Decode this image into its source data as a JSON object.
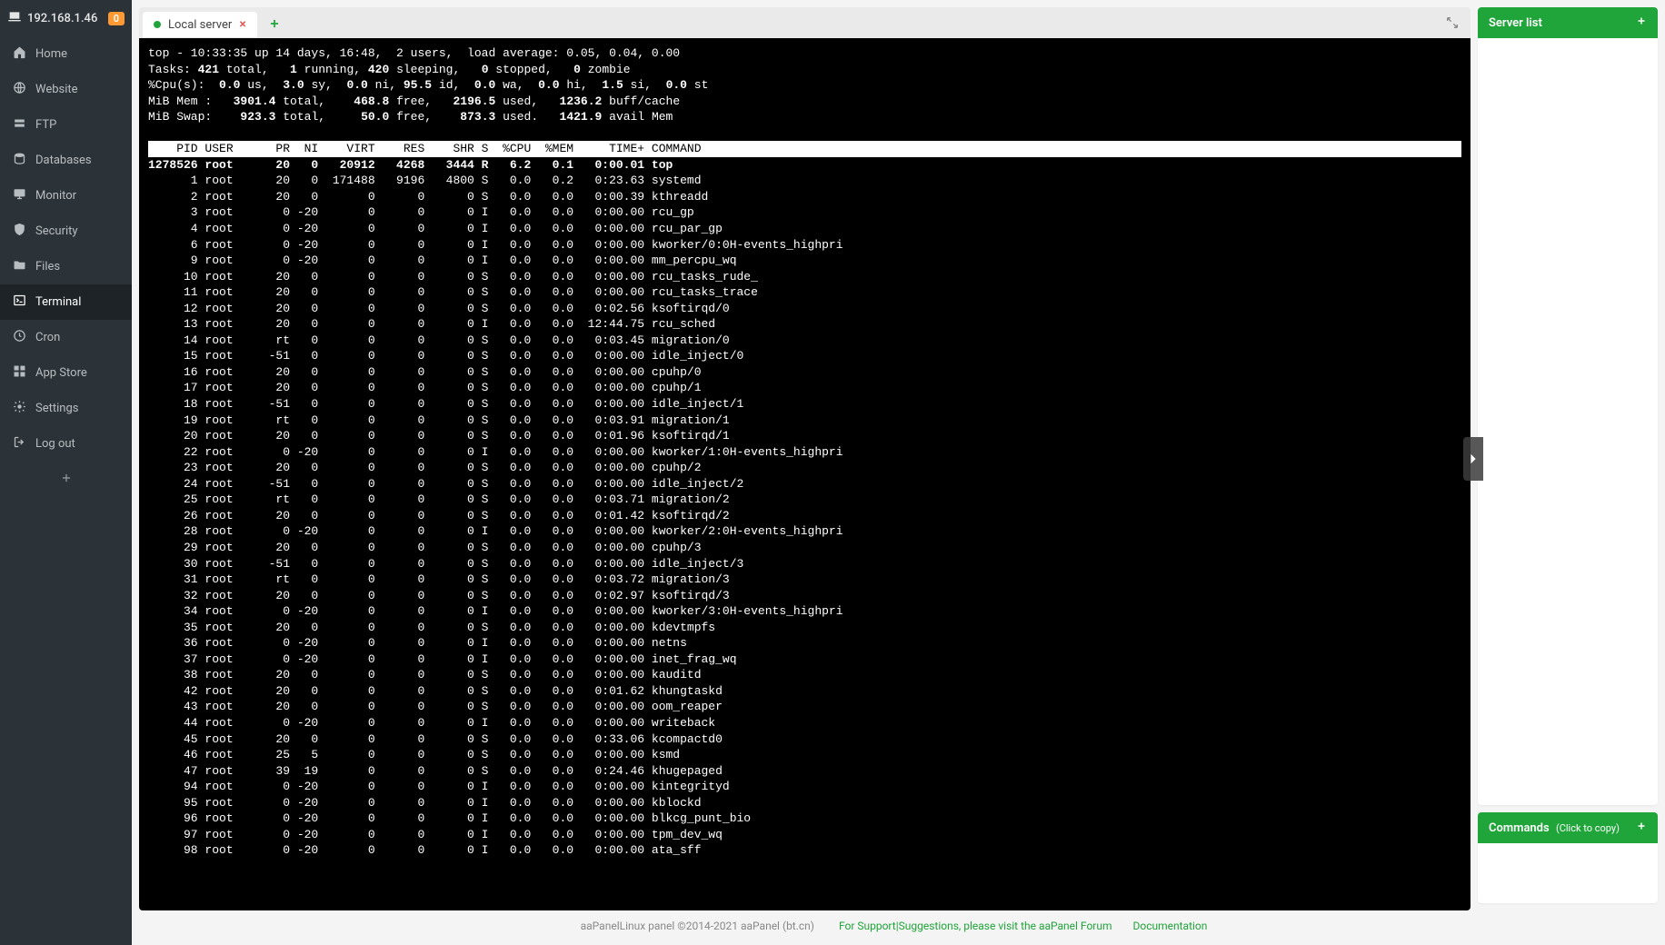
{
  "sidebar": {
    "ip": "192.168.1.46",
    "badge": "0",
    "items": [
      {
        "icon": "home",
        "label": "Home"
      },
      {
        "icon": "globe",
        "label": "Website"
      },
      {
        "icon": "ftp",
        "label": "FTP"
      },
      {
        "icon": "db",
        "label": "Databases"
      },
      {
        "icon": "monitor",
        "label": "Monitor"
      },
      {
        "icon": "shield",
        "label": "Security"
      },
      {
        "icon": "folder",
        "label": "Files"
      },
      {
        "icon": "terminal",
        "label": "Terminal"
      },
      {
        "icon": "clock",
        "label": "Cron"
      },
      {
        "icon": "grid",
        "label": "App Store"
      },
      {
        "icon": "gear",
        "label": "Settings"
      },
      {
        "icon": "logout",
        "label": "Log out"
      }
    ],
    "active_index": 7
  },
  "tabs": {
    "active": {
      "label": "Local server"
    }
  },
  "right": {
    "server_list": "Server list",
    "commands": "Commands",
    "commands_sub": "(Click to copy)"
  },
  "footer": {
    "copy": "aaPanelLinux panel ©2014-2021 aaPanel (bt.cn)",
    "forum": "For Support|Suggestions, please visit the aaPanel Forum",
    "docs": "Documentation"
  },
  "top": {
    "summary": {
      "line1": "top - 10:33:35 up 14 days, 16:48,  2 users,  load average: 0.05, 0.04, 0.00",
      "tasks": {
        "total": "421",
        "running": "1",
        "sleeping": "420",
        "stopped": "0",
        "zombie": "0"
      },
      "cpu": {
        "us": "0.0",
        "sy": "3.0",
        "ni": "0.0",
        "id": "95.5",
        "wa": "0.0",
        "hi": "0.0",
        "si": "1.5",
        "st": "0.0"
      },
      "mem": {
        "total": "3901.4",
        "free": "468.8",
        "used": "2196.5",
        "buff": "1236.2"
      },
      "swap": {
        "total": "923.3",
        "free": "50.0",
        "used": "873.3",
        "avail": "1421.9"
      }
    },
    "header": "    PID USER      PR  NI    VIRT    RES    SHR S  %CPU  %MEM     TIME+ COMMAND                                                          ",
    "rows": [
      {
        "pid": "1278526",
        "user": "root",
        "pr": "20",
        "ni": "0",
        "virt": "20912",
        "res": "4268",
        "shr": "3444",
        "s": "R",
        "cpu": "6.2",
        "mem": "0.1",
        "time": "0:00.01",
        "cmd": "top"
      },
      {
        "pid": "1",
        "user": "root",
        "pr": "20",
        "ni": "0",
        "virt": "171488",
        "res": "9196",
        "shr": "4800",
        "s": "S",
        "cpu": "0.0",
        "mem": "0.2",
        "time": "0:23.63",
        "cmd": "systemd"
      },
      {
        "pid": "2",
        "user": "root",
        "pr": "20",
        "ni": "0",
        "virt": "0",
        "res": "0",
        "shr": "0",
        "s": "S",
        "cpu": "0.0",
        "mem": "0.0",
        "time": "0:00.39",
        "cmd": "kthreadd"
      },
      {
        "pid": "3",
        "user": "root",
        "pr": "0",
        "ni": "-20",
        "virt": "0",
        "res": "0",
        "shr": "0",
        "s": "I",
        "cpu": "0.0",
        "mem": "0.0",
        "time": "0:00.00",
        "cmd": "rcu_gp"
      },
      {
        "pid": "4",
        "user": "root",
        "pr": "0",
        "ni": "-20",
        "virt": "0",
        "res": "0",
        "shr": "0",
        "s": "I",
        "cpu": "0.0",
        "mem": "0.0",
        "time": "0:00.00",
        "cmd": "rcu_par_gp"
      },
      {
        "pid": "6",
        "user": "root",
        "pr": "0",
        "ni": "-20",
        "virt": "0",
        "res": "0",
        "shr": "0",
        "s": "I",
        "cpu": "0.0",
        "mem": "0.0",
        "time": "0:00.00",
        "cmd": "kworker/0:0H-events_highpri"
      },
      {
        "pid": "9",
        "user": "root",
        "pr": "0",
        "ni": "-20",
        "virt": "0",
        "res": "0",
        "shr": "0",
        "s": "I",
        "cpu": "0.0",
        "mem": "0.0",
        "time": "0:00.00",
        "cmd": "mm_percpu_wq"
      },
      {
        "pid": "10",
        "user": "root",
        "pr": "20",
        "ni": "0",
        "virt": "0",
        "res": "0",
        "shr": "0",
        "s": "S",
        "cpu": "0.0",
        "mem": "0.0",
        "time": "0:00.00",
        "cmd": "rcu_tasks_rude_"
      },
      {
        "pid": "11",
        "user": "root",
        "pr": "20",
        "ni": "0",
        "virt": "0",
        "res": "0",
        "shr": "0",
        "s": "S",
        "cpu": "0.0",
        "mem": "0.0",
        "time": "0:00.00",
        "cmd": "rcu_tasks_trace"
      },
      {
        "pid": "12",
        "user": "root",
        "pr": "20",
        "ni": "0",
        "virt": "0",
        "res": "0",
        "shr": "0",
        "s": "S",
        "cpu": "0.0",
        "mem": "0.0",
        "time": "0:02.56",
        "cmd": "ksoftirqd/0"
      },
      {
        "pid": "13",
        "user": "root",
        "pr": "20",
        "ni": "0",
        "virt": "0",
        "res": "0",
        "shr": "0",
        "s": "I",
        "cpu": "0.0",
        "mem": "0.0",
        "time": "12:44.75",
        "cmd": "rcu_sched"
      },
      {
        "pid": "14",
        "user": "root",
        "pr": "rt",
        "ni": "0",
        "virt": "0",
        "res": "0",
        "shr": "0",
        "s": "S",
        "cpu": "0.0",
        "mem": "0.0",
        "time": "0:03.45",
        "cmd": "migration/0"
      },
      {
        "pid": "15",
        "user": "root",
        "pr": "-51",
        "ni": "0",
        "virt": "0",
        "res": "0",
        "shr": "0",
        "s": "S",
        "cpu": "0.0",
        "mem": "0.0",
        "time": "0:00.00",
        "cmd": "idle_inject/0"
      },
      {
        "pid": "16",
        "user": "root",
        "pr": "20",
        "ni": "0",
        "virt": "0",
        "res": "0",
        "shr": "0",
        "s": "S",
        "cpu": "0.0",
        "mem": "0.0",
        "time": "0:00.00",
        "cmd": "cpuhp/0"
      },
      {
        "pid": "17",
        "user": "root",
        "pr": "20",
        "ni": "0",
        "virt": "0",
        "res": "0",
        "shr": "0",
        "s": "S",
        "cpu": "0.0",
        "mem": "0.0",
        "time": "0:00.00",
        "cmd": "cpuhp/1"
      },
      {
        "pid": "18",
        "user": "root",
        "pr": "-51",
        "ni": "0",
        "virt": "0",
        "res": "0",
        "shr": "0",
        "s": "S",
        "cpu": "0.0",
        "mem": "0.0",
        "time": "0:00.00",
        "cmd": "idle_inject/1"
      },
      {
        "pid": "19",
        "user": "root",
        "pr": "rt",
        "ni": "0",
        "virt": "0",
        "res": "0",
        "shr": "0",
        "s": "S",
        "cpu": "0.0",
        "mem": "0.0",
        "time": "0:03.91",
        "cmd": "migration/1"
      },
      {
        "pid": "20",
        "user": "root",
        "pr": "20",
        "ni": "0",
        "virt": "0",
        "res": "0",
        "shr": "0",
        "s": "S",
        "cpu": "0.0",
        "mem": "0.0",
        "time": "0:01.96",
        "cmd": "ksoftirqd/1"
      },
      {
        "pid": "22",
        "user": "root",
        "pr": "0",
        "ni": "-20",
        "virt": "0",
        "res": "0",
        "shr": "0",
        "s": "I",
        "cpu": "0.0",
        "mem": "0.0",
        "time": "0:00.00",
        "cmd": "kworker/1:0H-events_highpri"
      },
      {
        "pid": "23",
        "user": "root",
        "pr": "20",
        "ni": "0",
        "virt": "0",
        "res": "0",
        "shr": "0",
        "s": "S",
        "cpu": "0.0",
        "mem": "0.0",
        "time": "0:00.00",
        "cmd": "cpuhp/2"
      },
      {
        "pid": "24",
        "user": "root",
        "pr": "-51",
        "ni": "0",
        "virt": "0",
        "res": "0",
        "shr": "0",
        "s": "S",
        "cpu": "0.0",
        "mem": "0.0",
        "time": "0:00.00",
        "cmd": "idle_inject/2"
      },
      {
        "pid": "25",
        "user": "root",
        "pr": "rt",
        "ni": "0",
        "virt": "0",
        "res": "0",
        "shr": "0",
        "s": "S",
        "cpu": "0.0",
        "mem": "0.0",
        "time": "0:03.71",
        "cmd": "migration/2"
      },
      {
        "pid": "26",
        "user": "root",
        "pr": "20",
        "ni": "0",
        "virt": "0",
        "res": "0",
        "shr": "0",
        "s": "S",
        "cpu": "0.0",
        "mem": "0.0",
        "time": "0:01.42",
        "cmd": "ksoftirqd/2"
      },
      {
        "pid": "28",
        "user": "root",
        "pr": "0",
        "ni": "-20",
        "virt": "0",
        "res": "0",
        "shr": "0",
        "s": "I",
        "cpu": "0.0",
        "mem": "0.0",
        "time": "0:00.00",
        "cmd": "kworker/2:0H-events_highpri"
      },
      {
        "pid": "29",
        "user": "root",
        "pr": "20",
        "ni": "0",
        "virt": "0",
        "res": "0",
        "shr": "0",
        "s": "S",
        "cpu": "0.0",
        "mem": "0.0",
        "time": "0:00.00",
        "cmd": "cpuhp/3"
      },
      {
        "pid": "30",
        "user": "root",
        "pr": "-51",
        "ni": "0",
        "virt": "0",
        "res": "0",
        "shr": "0",
        "s": "S",
        "cpu": "0.0",
        "mem": "0.0",
        "time": "0:00.00",
        "cmd": "idle_inject/3"
      },
      {
        "pid": "31",
        "user": "root",
        "pr": "rt",
        "ni": "0",
        "virt": "0",
        "res": "0",
        "shr": "0",
        "s": "S",
        "cpu": "0.0",
        "mem": "0.0",
        "time": "0:03.72",
        "cmd": "migration/3"
      },
      {
        "pid": "32",
        "user": "root",
        "pr": "20",
        "ni": "0",
        "virt": "0",
        "res": "0",
        "shr": "0",
        "s": "S",
        "cpu": "0.0",
        "mem": "0.0",
        "time": "0:02.97",
        "cmd": "ksoftirqd/3"
      },
      {
        "pid": "34",
        "user": "root",
        "pr": "0",
        "ni": "-20",
        "virt": "0",
        "res": "0",
        "shr": "0",
        "s": "I",
        "cpu": "0.0",
        "mem": "0.0",
        "time": "0:00.00",
        "cmd": "kworker/3:0H-events_highpri"
      },
      {
        "pid": "35",
        "user": "root",
        "pr": "20",
        "ni": "0",
        "virt": "0",
        "res": "0",
        "shr": "0",
        "s": "S",
        "cpu": "0.0",
        "mem": "0.0",
        "time": "0:00.00",
        "cmd": "kdevtmpfs"
      },
      {
        "pid": "36",
        "user": "root",
        "pr": "0",
        "ni": "-20",
        "virt": "0",
        "res": "0",
        "shr": "0",
        "s": "I",
        "cpu": "0.0",
        "mem": "0.0",
        "time": "0:00.00",
        "cmd": "netns"
      },
      {
        "pid": "37",
        "user": "root",
        "pr": "0",
        "ni": "-20",
        "virt": "0",
        "res": "0",
        "shr": "0",
        "s": "I",
        "cpu": "0.0",
        "mem": "0.0",
        "time": "0:00.00",
        "cmd": "inet_frag_wq"
      },
      {
        "pid": "38",
        "user": "root",
        "pr": "20",
        "ni": "0",
        "virt": "0",
        "res": "0",
        "shr": "0",
        "s": "S",
        "cpu": "0.0",
        "mem": "0.0",
        "time": "0:00.00",
        "cmd": "kauditd"
      },
      {
        "pid": "42",
        "user": "root",
        "pr": "20",
        "ni": "0",
        "virt": "0",
        "res": "0",
        "shr": "0",
        "s": "S",
        "cpu": "0.0",
        "mem": "0.0",
        "time": "0:01.62",
        "cmd": "khungtaskd"
      },
      {
        "pid": "43",
        "user": "root",
        "pr": "20",
        "ni": "0",
        "virt": "0",
        "res": "0",
        "shr": "0",
        "s": "S",
        "cpu": "0.0",
        "mem": "0.0",
        "time": "0:00.00",
        "cmd": "oom_reaper"
      },
      {
        "pid": "44",
        "user": "root",
        "pr": "0",
        "ni": "-20",
        "virt": "0",
        "res": "0",
        "shr": "0",
        "s": "I",
        "cpu": "0.0",
        "mem": "0.0",
        "time": "0:00.00",
        "cmd": "writeback"
      },
      {
        "pid": "45",
        "user": "root",
        "pr": "20",
        "ni": "0",
        "virt": "0",
        "res": "0",
        "shr": "0",
        "s": "S",
        "cpu": "0.0",
        "mem": "0.0",
        "time": "0:33.06",
        "cmd": "kcompactd0"
      },
      {
        "pid": "46",
        "user": "root",
        "pr": "25",
        "ni": "5",
        "virt": "0",
        "res": "0",
        "shr": "0",
        "s": "S",
        "cpu": "0.0",
        "mem": "0.0",
        "time": "0:00.00",
        "cmd": "ksmd"
      },
      {
        "pid": "47",
        "user": "root",
        "pr": "39",
        "ni": "19",
        "virt": "0",
        "res": "0",
        "shr": "0",
        "s": "S",
        "cpu": "0.0",
        "mem": "0.0",
        "time": "0:24.46",
        "cmd": "khugepaged"
      },
      {
        "pid": "94",
        "user": "root",
        "pr": "0",
        "ni": "-20",
        "virt": "0",
        "res": "0",
        "shr": "0",
        "s": "I",
        "cpu": "0.0",
        "mem": "0.0",
        "time": "0:00.00",
        "cmd": "kintegrityd"
      },
      {
        "pid": "95",
        "user": "root",
        "pr": "0",
        "ni": "-20",
        "virt": "0",
        "res": "0",
        "shr": "0",
        "s": "I",
        "cpu": "0.0",
        "mem": "0.0",
        "time": "0:00.00",
        "cmd": "kblockd"
      },
      {
        "pid": "96",
        "user": "root",
        "pr": "0",
        "ni": "-20",
        "virt": "0",
        "res": "0",
        "shr": "0",
        "s": "I",
        "cpu": "0.0",
        "mem": "0.0",
        "time": "0:00.00",
        "cmd": "blkcg_punt_bio"
      },
      {
        "pid": "97",
        "user": "root",
        "pr": "0",
        "ni": "-20",
        "virt": "0",
        "res": "0",
        "shr": "0",
        "s": "I",
        "cpu": "0.0",
        "mem": "0.0",
        "time": "0:00.00",
        "cmd": "tpm_dev_wq"
      },
      {
        "pid": "98",
        "user": "root",
        "pr": "0",
        "ni": "-20",
        "virt": "0",
        "res": "0",
        "shr": "0",
        "s": "I",
        "cpu": "0.0",
        "mem": "0.0",
        "time": "0:00.00",
        "cmd": "ata_sff"
      }
    ]
  }
}
